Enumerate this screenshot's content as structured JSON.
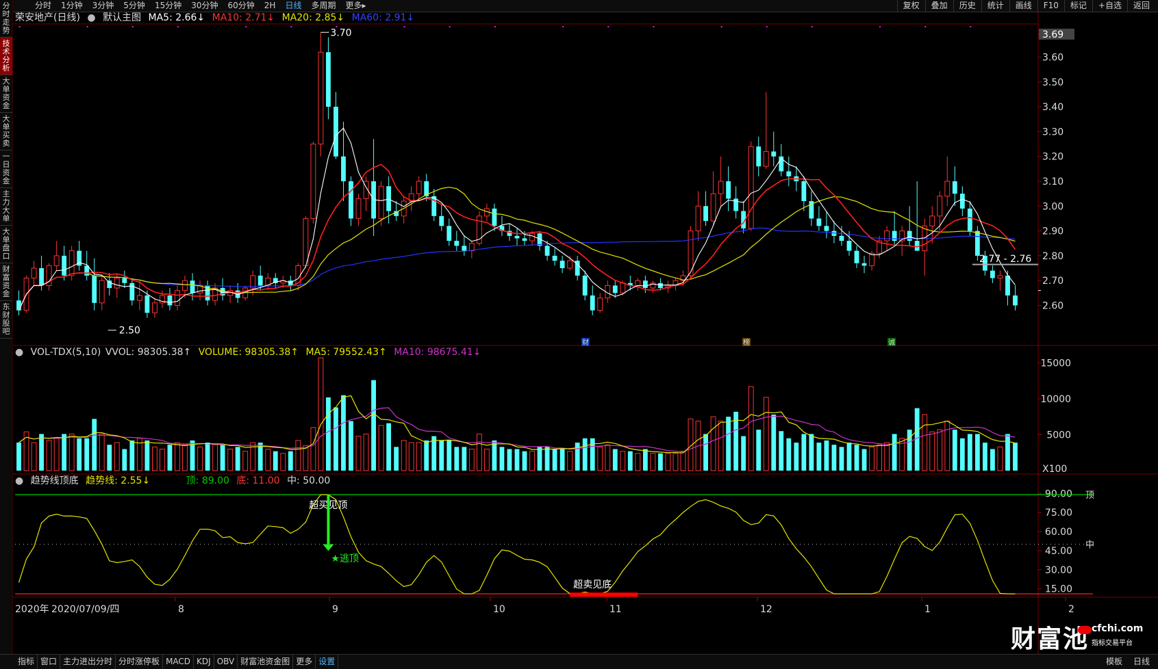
{
  "top_tabs": [
    "分时",
    "1分钟",
    "3分钟",
    "5分钟",
    "15分钟",
    "30分钟",
    "60分钟",
    "2H",
    "日线",
    "多周期",
    "更多▸"
  ],
  "top_active": "日线",
  "top_right": [
    "复权",
    "叠加",
    "历史",
    "统计",
    "画线",
    "F10",
    "标记",
    "+自选",
    "返回"
  ],
  "sidebar": [
    "分时走势",
    "技术分析",
    "大单资金",
    "大单买卖",
    "一日资金",
    "主力大单",
    "大单盘口",
    "财富资金",
    "东财股吧"
  ],
  "sidebar_active": "技术分析",
  "header": {
    "stock": "荣安地产(日线)",
    "main_label": "默认主图",
    "ma5": "MA5: 2.66↓",
    "ma10": "MA10: 2.71↓",
    "ma20": "MA20: 2.85↓",
    "ma60": "MA60: 2.91↓"
  },
  "vol_header": {
    "name": "VOL-TDX(5,10)",
    "vvol": "VVOL: 98305.38↑",
    "volume": "VOLUME: 98305.38↑",
    "ma5": "MA5: 79552.43↑",
    "ma10": "MA10: 98675.41↓"
  },
  "ind_header": {
    "name": "趋势线顶底",
    "trend": "趋势线: 2.55↓",
    "top": "顶: 89.00",
    "bottom": "底: 11.00",
    "mid": "中: 50.00"
  },
  "bottom_items": [
    "指标",
    "窗口",
    "主力进出分时",
    "分时涨停板",
    "MACD",
    "KDJ",
    "OBV",
    "财富池资金图",
    "更多",
    "设置"
  ],
  "bottom_active": "设置",
  "bottom_right": [
    "模板",
    "日线"
  ],
  "logo": {
    "text": "财富池",
    "site": "cfchi.com",
    "tagline": "指标交易平台"
  },
  "colors": {
    "up": "#ff3333",
    "down": "#54ffff",
    "ma5": "#ffffff",
    "ma10": "#ff2020",
    "ma20": "#e6e600",
    "ma60": "#2233ff",
    "vol_ma5": "#e6e600",
    "vol_ma10": "#cc33cc",
    "trend": "#e6e600",
    "top_line": "#00cc00",
    "bottom_line": "#ff2020"
  },
  "chart_data": [
    {
      "type": "candlestick",
      "title": "荣安地产(日线)",
      "ylim": [
        2.48,
        3.72
      ],
      "yticks": [
        "3.69",
        "3.60",
        "3.50",
        "3.40",
        "3.30",
        "3.20",
        "3.10",
        "3.00",
        "2.90",
        "2.80",
        "2.70",
        "2.60"
      ],
      "x_month_labels": [
        "2020年",
        "2020/07/09/四",
        "8",
        "9",
        "10",
        "11",
        "12",
        "1",
        "2"
      ],
      "annotations": [
        "3.70",
        "2.50",
        "2.77 - 2.76"
      ],
      "event_markers": [
        "财",
        "榜",
        "诚"
      ],
      "max_price": 3.7,
      "min_price": 2.5,
      "ohlc": [
        [
          2.62,
          2.66,
          2.56,
          2.58
        ],
        [
          2.58,
          2.72,
          2.57,
          2.71
        ],
        [
          2.71,
          2.78,
          2.68,
          2.75
        ],
        [
          2.75,
          2.8,
          2.66,
          2.68
        ],
        [
          2.68,
          2.77,
          2.66,
          2.76
        ],
        [
          2.76,
          2.86,
          2.74,
          2.8
        ],
        [
          2.8,
          2.84,
          2.7,
          2.72
        ],
        [
          2.72,
          2.84,
          2.7,
          2.82
        ],
        [
          2.82,
          2.86,
          2.74,
          2.76
        ],
        [
          2.76,
          2.82,
          2.7,
          2.72
        ],
        [
          2.72,
          2.79,
          2.58,
          2.61
        ],
        [
          2.61,
          2.72,
          2.58,
          2.7
        ],
        [
          2.7,
          2.73,
          2.64,
          2.67
        ],
        [
          2.67,
          2.73,
          2.63,
          2.71
        ],
        [
          2.71,
          2.74,
          2.67,
          2.69
        ],
        [
          2.69,
          2.71,
          2.6,
          2.62
        ],
        [
          2.62,
          2.7,
          2.58,
          2.64
        ],
        [
          2.64,
          2.66,
          2.55,
          2.57
        ],
        [
          2.57,
          2.63,
          2.55,
          2.61
        ],
        [
          2.61,
          2.66,
          2.59,
          2.64
        ],
        [
          2.64,
          2.67,
          2.58,
          2.6
        ],
        [
          2.6,
          2.68,
          2.58,
          2.66
        ],
        [
          2.66,
          2.72,
          2.63,
          2.7
        ],
        [
          2.7,
          2.73,
          2.62,
          2.65
        ],
        [
          2.65,
          2.7,
          2.62,
          2.68
        ],
        [
          2.68,
          2.7,
          2.6,
          2.62
        ],
        [
          2.62,
          2.69,
          2.6,
          2.67
        ],
        [
          2.67,
          2.71,
          2.62,
          2.64
        ],
        [
          2.64,
          2.68,
          2.61,
          2.66
        ],
        [
          2.66,
          2.69,
          2.61,
          2.63
        ],
        [
          2.63,
          2.68,
          2.62,
          2.67
        ],
        [
          2.67,
          2.74,
          2.64,
          2.72
        ],
        [
          2.72,
          2.76,
          2.66,
          2.68
        ],
        [
          2.68,
          2.73,
          2.66,
          2.71
        ],
        [
          2.71,
          2.73,
          2.67,
          2.69
        ],
        [
          2.69,
          2.72,
          2.67,
          2.7
        ],
        [
          2.7,
          2.72,
          2.66,
          2.68
        ],
        [
          2.68,
          2.77,
          2.66,
          2.76
        ],
        [
          2.76,
          2.96,
          2.75,
          2.95
        ],
        [
          2.95,
          3.26,
          2.93,
          3.25
        ],
        [
          3.25,
          3.7,
          3.2,
          3.62
        ],
        [
          3.62,
          3.68,
          3.35,
          3.4
        ],
        [
          3.4,
          3.46,
          3.19,
          3.2
        ],
        [
          3.2,
          3.34,
          3.02,
          3.1
        ],
        [
          3.1,
          3.12,
          2.92,
          2.95
        ],
        [
          2.95,
          3.05,
          2.92,
          3.03
        ],
        [
          3.03,
          3.12,
          2.98,
          3.1
        ],
        [
          3.1,
          3.27,
          2.88,
          2.95
        ],
        [
          2.95,
          3.1,
          2.92,
          3.08
        ],
        [
          3.08,
          3.12,
          2.93,
          2.98
        ],
        [
          2.98,
          3.02,
          2.94,
          2.96
        ],
        [
          2.96,
          3.04,
          2.93,
          3.02
        ],
        [
          3.02,
          3.08,
          2.98,
          3.05
        ],
        [
          3.05,
          3.12,
          3.02,
          3.1
        ],
        [
          3.1,
          3.13,
          3.02,
          3.04
        ],
        [
          3.04,
          3.07,
          2.94,
          2.96
        ],
        [
          2.96,
          3.01,
          2.9,
          2.92
        ],
        [
          2.92,
          2.95,
          2.84,
          2.86
        ],
        [
          2.86,
          2.9,
          2.82,
          2.84
        ],
        [
          2.84,
          2.88,
          2.8,
          2.82
        ],
        [
          2.82,
          2.86,
          2.79,
          2.85
        ],
        [
          2.85,
          2.98,
          2.84,
          2.96
        ],
        [
          2.96,
          3.01,
          2.94,
          2.99
        ],
        [
          2.99,
          3.01,
          2.9,
          2.92
        ],
        [
          2.92,
          2.96,
          2.88,
          2.9
        ],
        [
          2.9,
          2.93,
          2.86,
          2.88
        ],
        [
          2.88,
          2.91,
          2.84,
          2.87
        ],
        [
          2.87,
          2.9,
          2.84,
          2.86
        ],
        [
          2.86,
          2.9,
          2.84,
          2.89
        ],
        [
          2.89,
          2.9,
          2.82,
          2.84
        ],
        [
          2.84,
          2.86,
          2.78,
          2.8
        ],
        [
          2.8,
          2.83,
          2.76,
          2.78
        ],
        [
          2.78,
          2.8,
          2.73,
          2.75
        ],
        [
          2.75,
          2.8,
          2.74,
          2.78
        ],
        [
          2.78,
          2.8,
          2.7,
          2.72
        ],
        [
          2.72,
          2.74,
          2.62,
          2.64
        ],
        [
          2.64,
          2.68,
          2.56,
          2.58
        ],
        [
          2.58,
          2.65,
          2.57,
          2.63
        ],
        [
          2.63,
          2.7,
          2.61,
          2.68
        ],
        [
          2.68,
          2.7,
          2.63,
          2.65
        ],
        [
          2.65,
          2.7,
          2.64,
          2.69
        ],
        [
          2.69,
          2.72,
          2.66,
          2.68
        ],
        [
          2.68,
          2.71,
          2.66,
          2.7
        ],
        [
          2.7,
          2.72,
          2.65,
          2.67
        ],
        [
          2.67,
          2.7,
          2.65,
          2.69
        ],
        [
          2.69,
          2.71,
          2.66,
          2.67
        ],
        [
          2.67,
          2.7,
          2.65,
          2.68
        ],
        [
          2.68,
          2.71,
          2.66,
          2.7
        ],
        [
          2.7,
          2.74,
          2.68,
          2.72
        ],
        [
          2.72,
          2.92,
          2.71,
          2.9
        ],
        [
          2.9,
          3.06,
          2.86,
          3.0
        ],
        [
          3.0,
          3.06,
          2.92,
          2.94
        ],
        [
          2.94,
          3.14,
          2.92,
          3.05
        ],
        [
          3.05,
          3.2,
          3.0,
          3.1
        ],
        [
          3.1,
          3.16,
          2.98,
          3.03
        ],
        [
          3.03,
          3.08,
          2.95,
          2.98
        ],
        [
          2.98,
          3.02,
          2.89,
          2.91
        ],
        [
          2.91,
          3.26,
          2.9,
          3.24
        ],
        [
          3.24,
          3.28,
          3.12,
          3.16
        ],
        [
          3.16,
          3.46,
          3.15,
          3.22
        ],
        [
          3.22,
          3.3,
          3.16,
          3.2
        ],
        [
          3.2,
          3.25,
          3.12,
          3.14
        ],
        [
          3.14,
          3.2,
          3.08,
          3.12
        ],
        [
          3.12,
          3.16,
          3.06,
          3.1
        ],
        [
          3.1,
          3.12,
          2.98,
          3.02
        ],
        [
          3.02,
          3.06,
          2.92,
          2.95
        ],
        [
          2.95,
          3.0,
          2.9,
          2.92
        ],
        [
          2.92,
          2.98,
          2.87,
          2.9
        ],
        [
          2.9,
          2.94,
          2.85,
          2.88
        ],
        [
          2.88,
          2.92,
          2.84,
          2.86
        ],
        [
          2.86,
          2.9,
          2.8,
          2.82
        ],
        [
          2.82,
          2.84,
          2.75,
          2.77
        ],
        [
          2.77,
          2.8,
          2.73,
          2.76
        ],
        [
          2.76,
          2.82,
          2.74,
          2.81
        ],
        [
          2.81,
          2.88,
          2.79,
          2.86
        ],
        [
          2.86,
          2.92,
          2.82,
          2.9
        ],
        [
          2.9,
          2.98,
          2.84,
          2.86
        ],
        [
          2.86,
          2.92,
          2.8,
          2.9
        ],
        [
          2.9,
          3.0,
          2.84,
          2.86
        ],
        [
          2.86,
          3.1,
          2.84,
          2.82
        ],
        [
          2.82,
          2.95,
          2.72,
          2.92
        ],
        [
          2.92,
          3.0,
          2.85,
          2.96
        ],
        [
          2.96,
          3.06,
          2.9,
          3.04
        ],
        [
          3.04,
          3.2,
          3.0,
          3.1
        ],
        [
          3.1,
          3.16,
          3.0,
          3.05
        ],
        [
          3.05,
          3.08,
          2.96,
          2.99
        ],
        [
          2.99,
          3.02,
          2.88,
          2.9
        ],
        [
          2.9,
          2.92,
          2.78,
          2.8
        ],
        [
          2.8,
          2.82,
          2.72,
          2.74
        ],
        [
          2.74,
          2.76,
          2.69,
          2.71
        ],
        [
          2.71,
          2.74,
          2.66,
          2.72
        ],
        [
          2.72,
          2.74,
          2.6,
          2.64
        ],
        [
          2.64,
          2.68,
          2.58,
          2.6
        ]
      ],
      "ma60_note": "MA60 flat near 2.91 at right edge"
    },
    {
      "type": "bar",
      "title": "VOL-TDX(5,10)",
      "ylabel": "X100",
      "ylim": [
        0,
        16000
      ],
      "yticks": [
        "15000",
        "10000",
        "5000"
      ]
    },
    {
      "type": "line",
      "title": "趋势线顶底",
      "ylim": [
        10,
        95
      ],
      "yticks": [
        "90.00",
        "75.00",
        "60.00",
        "45.00",
        "30.00",
        "15.00"
      ],
      "reference_lines": {
        "top": 89.0,
        "mid": 50.0,
        "bottom": 11.0
      },
      "annotations": [
        "超买见顶",
        "★逃顶",
        "超卖见底",
        "顶",
        "中"
      ]
    }
  ]
}
